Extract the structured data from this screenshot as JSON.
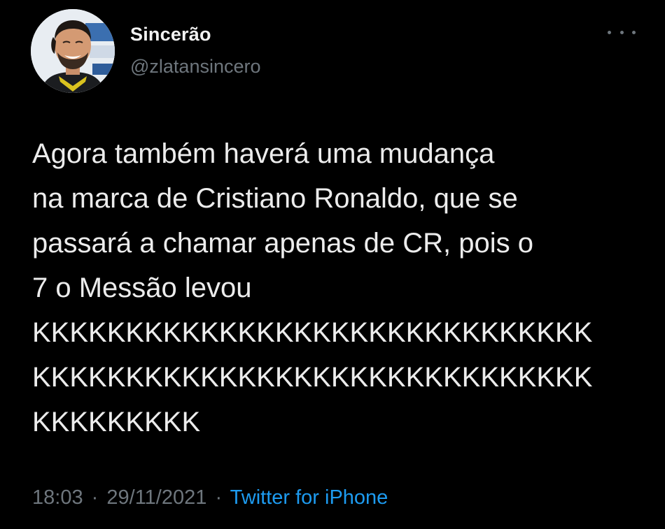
{
  "author": {
    "display_name": "Sincerão",
    "handle": "@zlatansincero",
    "avatar": "avatar-photo"
  },
  "menu": {
    "icon": "more-horizontal-icon"
  },
  "tweet": {
    "text": "Agora também haverá uma mudança\nna marca de Cristiano Ronaldo, que se\npassará a chamar apenas de CR, pois o\n7 o Messão levou\nKKKKKKKKKKKKKKKKKKKKKKKKKKKKKK\nKKKKKKKKKKKKKKKKKKKKKKKKKKKKKK\nKKKKKKKKK"
  },
  "meta": {
    "time": "18:03",
    "separator": "·",
    "date": "29/11/2021",
    "source": "Twitter for iPhone"
  },
  "colors": {
    "background": "#000000",
    "text": "#ececec",
    "secondary": "#6e767d",
    "link": "#1d9bf0"
  }
}
